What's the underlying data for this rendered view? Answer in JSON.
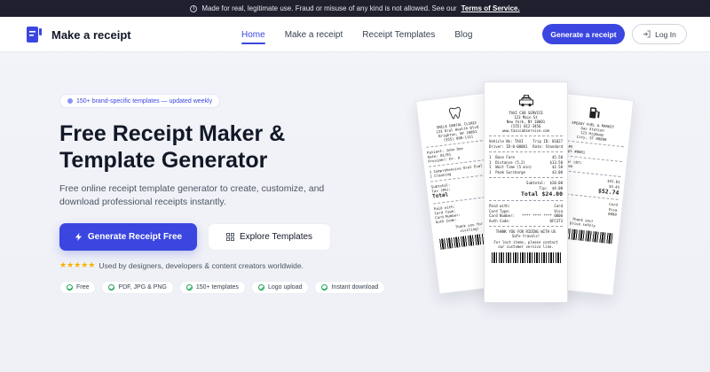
{
  "banner": {
    "text": "Made for real, legitimate use. Fraud or misuse of any kind is not allowed. See our",
    "link": "Terms of Service."
  },
  "header": {
    "brand": "Make a receipt",
    "nav": [
      {
        "label": "Home",
        "active": true
      },
      {
        "label": "Make a receipt",
        "active": false
      },
      {
        "label": "Receipt Templates",
        "active": false
      },
      {
        "label": "Blog",
        "active": false
      }
    ],
    "generate_button": "Generate a receipt",
    "login_button": "Log In"
  },
  "hero": {
    "pill": "150+ brand-specific templates — updated weekly",
    "title": "Free Receipt Maker & Template Generator",
    "subtitle": "Free online receipt template generator to create, customize, and download professional receipts instantly.",
    "primary_button": "Generate Receipt Free",
    "secondary_button": "Explore Templates",
    "rating_stars": 5,
    "rating_text": "Used by designers, developers & content creators worldwide.",
    "features": [
      "Free",
      "PDF, JPG & PNG",
      "150+ templates",
      "Logo upload",
      "Instant download"
    ]
  },
  "receipts": {
    "center": {
      "name": "TAXI CAB SERVICE",
      "address": [
        "123 Main St",
        "New York, NY 10001",
        "(555) 012-3456",
        "www.taxicabservice.com"
      ],
      "meta": [
        [
          "Vehicle No: TAXI",
          "Trip ID: 01027"
        ],
        [
          "Driver: ID-0-00001",
          "Rate: Standard"
        ]
      ],
      "items": [
        {
          "qty": "1",
          "desc": "Base Fare",
          "amt": "$5.50"
        },
        {
          "qty": "1",
          "desc": "Distance (5.2)",
          "amt": "$13.50"
        },
        {
          "qty": "1",
          "desc": "Wait Time (5 min)",
          "amt": "$1.50"
        },
        {
          "qty": "1",
          "desc": "Peak Surcharge",
          "amt": "$3.00"
        }
      ],
      "subtotal_label": "Subtotal:",
      "subtotal": "$20.00",
      "tip_label": "Tip:",
      "tip": "$4.00",
      "total_label": "Total",
      "total": "$24.00",
      "payment": [
        [
          "Paid with:",
          "Card"
        ],
        [
          "Card Type:",
          "Visa"
        ],
        [
          "Card Number:",
          "**** **** **** 0000"
        ],
        [
          "Auth Code:",
          "0FC3T3"
        ]
      ],
      "footer": [
        "THANK YOU FOR RIDING WITH US",
        "Safe travels!",
        "For lost items, please contact",
        "our customer service line."
      ]
    },
    "left": {
      "name": "SMILE DENTAL CLINIC",
      "lines": [
        "123 Oral Health Blvd",
        "Brighton, NY 10001",
        "(555) 000-1111"
      ],
      "meta": [
        "Patient: John Doe",
        "Date: 01/01",
        "Provider: Dr. A"
      ],
      "items": [
        "1 Comprehensive Oral Eval",
        "1 Cleaning"
      ],
      "subtotal": "Subtotal:",
      "tax": "Tax (0%):",
      "total": "Total",
      "payment": [
        "Paid with:",
        "Card Type:",
        "Card Number:",
        "Auth Code:"
      ],
      "footer": [
        "Thank you for",
        "visiting!"
      ]
    },
    "right": {
      "name": "SPEEDY FUEL & MARKET",
      "lines": [
        "Gas Station",
        "123 Highway",
        "City, ST 00000"
      ],
      "meta": [
        "Pump #5",
        "Receipt #0001"
      ],
      "items": [
        "Regular (87)",
        "Car Wash"
      ],
      "subtotal": "$41.81",
      "tax": "$3.45",
      "total": "$52.74",
      "payment": [
        "Card",
        "Visa",
        "0000"
      ],
      "footer": [
        "Thank you!",
        "Drive safely"
      ]
    }
  }
}
